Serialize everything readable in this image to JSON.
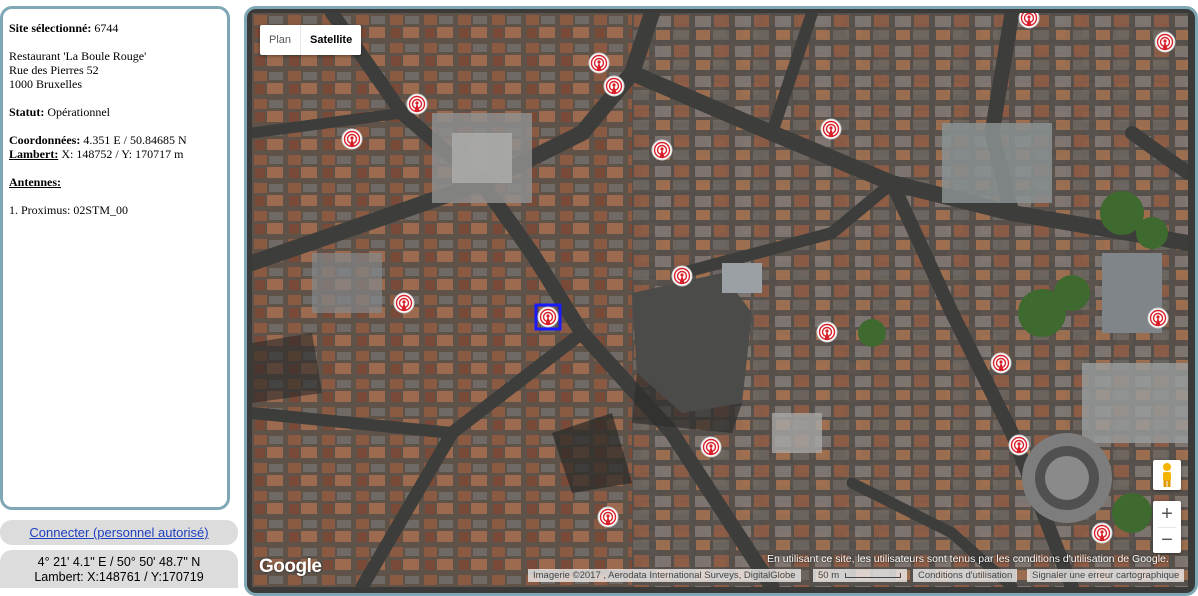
{
  "site": {
    "selected_label": "Site sélectionné:",
    "selected_value": "6744",
    "address_line1": "Restaurant 'La Boule Rouge'",
    "address_line2": "Rue des Pierres 52",
    "address_line3": "1000 Bruxelles",
    "status_label": "Statut:",
    "status_value": "Opérationnel",
    "coords_label": "Coordonnées:",
    "coords_value": "4.351 E / 50.84685 N",
    "lambert_label": "Lambert:",
    "lambert_value": "X: 148752 / Y: 170717 m",
    "antennas_label": "Antennes:",
    "antennas": [
      "1. Proximus: 02STM_00"
    ]
  },
  "connect_link": "Connecter (personnel autorisé)",
  "cursor_coords": {
    "dms": "4° 21' 4.1\" E / 50° 50' 48.7\" N",
    "lambert": "Lambert: X:148761 / Y:170719"
  },
  "map": {
    "type_plan": "Plan",
    "type_satellite": "Satellite",
    "active_type": "Satellite",
    "zoom_in": "+",
    "zoom_out": "−",
    "logo": "Google",
    "terms_message": "En utilisant ce site, les utilisateurs sont tenus par les conditions d'utilisation de Google.",
    "attribution": "Imagerie ©2017 , Aerodata International Surveys, DigitalGlobe",
    "scale_label": "50 m",
    "terms_link": "Conditions d'utilisation",
    "report_link": "Signaler une erreur cartographique",
    "pegman_icon": "pegman-icon",
    "antenna_icon": "antenna-marker-icon",
    "marker_color": "#d8202a",
    "selected_color": "#1a1aff"
  }
}
